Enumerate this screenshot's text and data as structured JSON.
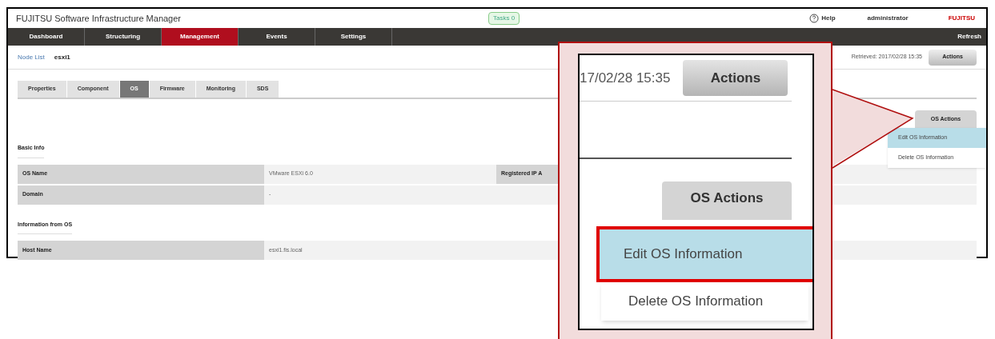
{
  "window": {
    "title": "FUJITSU Software Infrastructure Manager",
    "tasks": "Tasks 0",
    "help": "Help",
    "user": "administrator",
    "logo": "FUJITSU"
  },
  "nav": {
    "items": [
      {
        "label": "Dashboard",
        "selected": false
      },
      {
        "label": "Structuring",
        "selected": false
      },
      {
        "label": "Management",
        "selected": true
      },
      {
        "label": "Events",
        "selected": false
      },
      {
        "label": "Settings",
        "selected": false
      }
    ],
    "refresh": "Refresh"
  },
  "breadcrumb": {
    "link": "Node List",
    "current": "esxi1",
    "retrieved": "Retrieved: 2017/02/28 15:35",
    "actions": "Actions"
  },
  "tabs": [
    {
      "label": "Properties",
      "selected": false
    },
    {
      "label": "Component",
      "selected": false
    },
    {
      "label": "OS",
      "selected": true
    },
    {
      "label": "Firmware",
      "selected": false
    },
    {
      "label": "Monitoring",
      "selected": false
    },
    {
      "label": "SDS",
      "selected": false
    }
  ],
  "os_actions": {
    "label": "OS Actions",
    "menu": [
      {
        "label": "Edit OS Information",
        "selected": true
      },
      {
        "label": "Delete OS Information",
        "selected": false
      }
    ]
  },
  "sections": [
    {
      "title": "Basic Info",
      "rows": [
        {
          "label": "OS Name",
          "value": "VMware ESXi 6.0",
          "label_2": "Registered IP A"
        },
        {
          "label": "Domain",
          "value": "-"
        }
      ]
    },
    {
      "title": "Information from OS",
      "rows": [
        {
          "label": "Host Name",
          "value": "esxi1.fis.local"
        }
      ]
    }
  ],
  "callout": {
    "retrieved": "17/02/28 15:35",
    "actions": "Actions",
    "os_actions": "OS Actions",
    "menu": [
      {
        "label": "Edit OS Information",
        "selected": true
      },
      {
        "label": "Delete OS Information",
        "selected": false
      }
    ]
  }
}
